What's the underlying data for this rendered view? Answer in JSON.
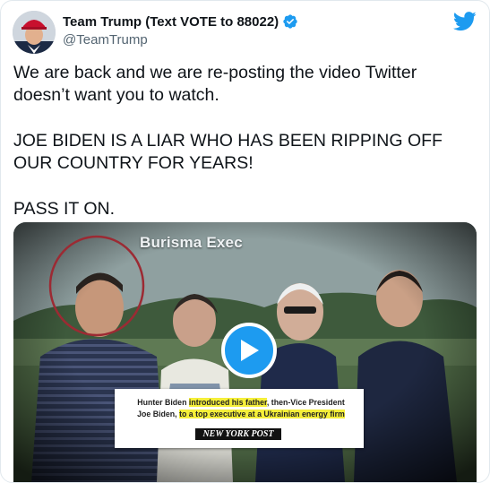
{
  "tweet": {
    "display_name": "Team Trump (Text VOTE to 88022)",
    "handle": "@TeamTrump",
    "paragraphs": [
      "We are back and we are re-posting the video Twitter doesn’t want you to watch.",
      "JOE BIDEN IS A LIAR WHO HAS BEEN RIPPING OFF OUR COUNTRY FOR YEARS!",
      "PASS IT ON."
    ]
  },
  "media": {
    "overlay_label": "Burisma Exec",
    "clipping": {
      "line1_a": "Hunter Biden ",
      "line1_highlight": "introduced his father",
      "line1_b": ", then-Vice President",
      "line2_a": "Joe Biden, ",
      "line2_highlight": "to a top executive at a Ukrainian energy firm",
      "source": "NEW YORK POST"
    }
  },
  "icons": {
    "verified": "verified-badge-icon",
    "brand": "twitter-bird-icon",
    "play": "play-icon"
  },
  "colors": {
    "accent": "#1d9bf0",
    "highlight": "#f5ef3a"
  }
}
